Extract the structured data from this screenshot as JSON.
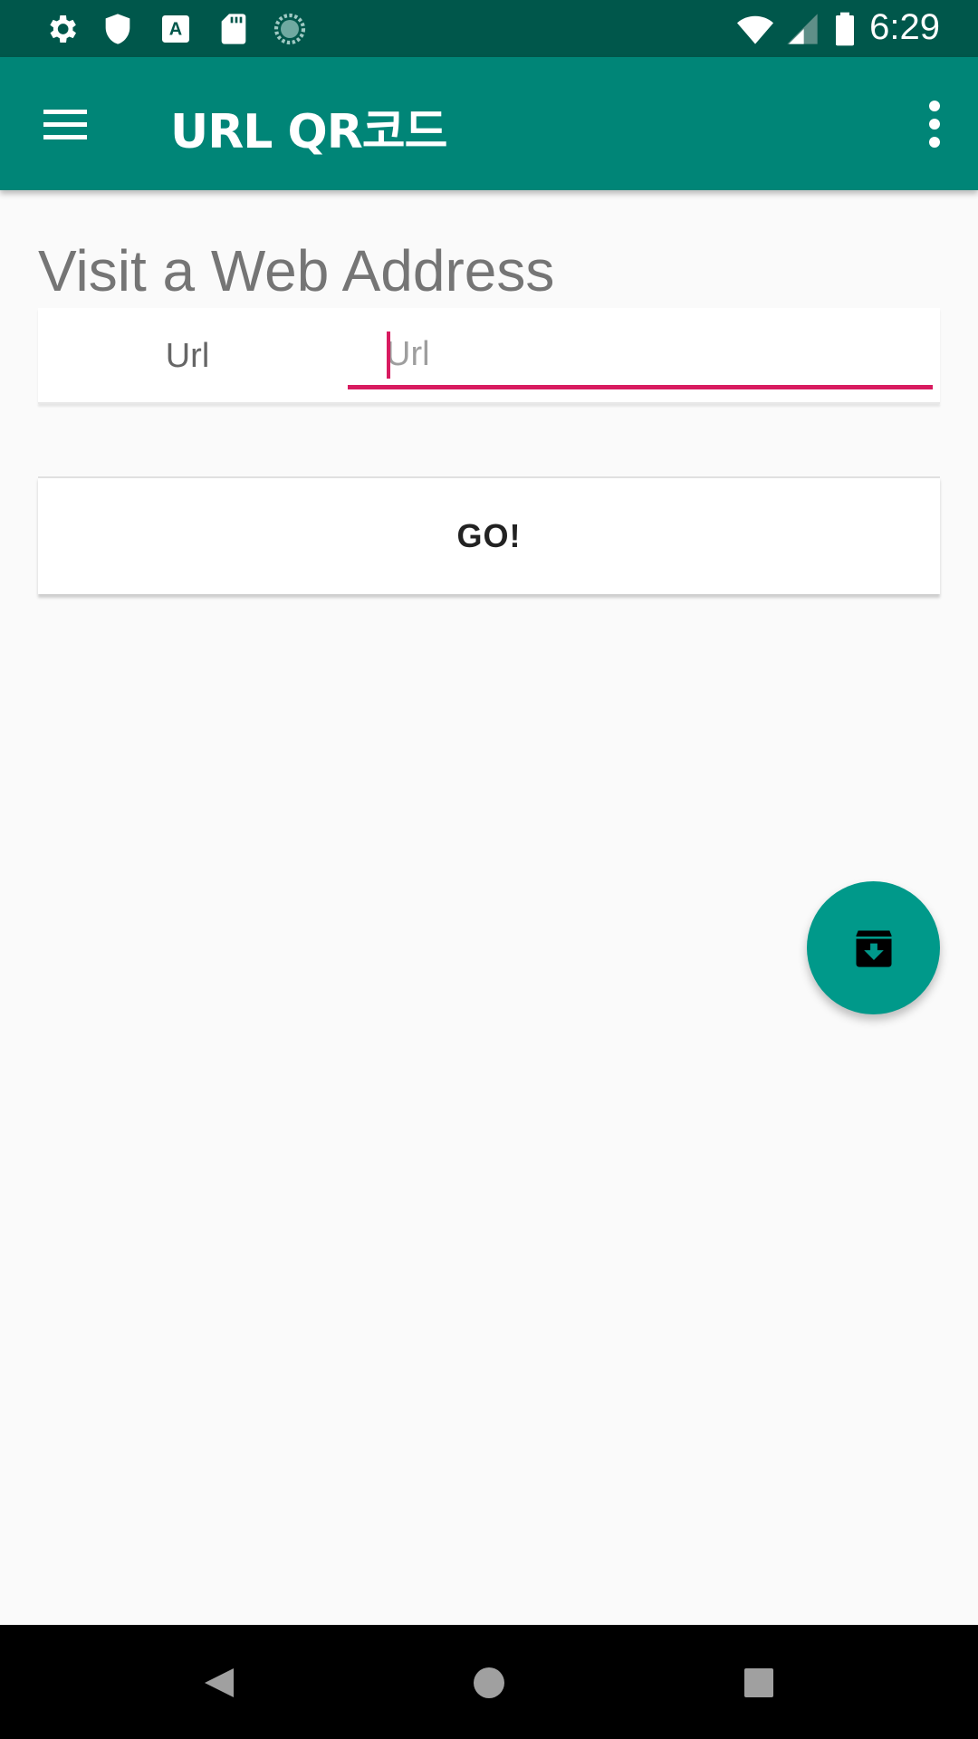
{
  "status_bar": {
    "time": "6:29",
    "left_icons": [
      "settings-icon",
      "shield-icon",
      "a-keyboard-icon",
      "sd-card-icon",
      "sync-icon"
    ],
    "right_icons": [
      "wifi-icon",
      "signal-icon",
      "battery-icon"
    ]
  },
  "app_bar": {
    "title": "URL QR코드",
    "menu_icon": "menu-icon",
    "overflow_icon": "more-vert-icon",
    "color": "#008577"
  },
  "main": {
    "heading": "Visit a Web Address",
    "url_label": "Url",
    "url_input": {
      "value": "",
      "placeholder": "Url"
    },
    "go_button_label": "GO!"
  },
  "fab": {
    "icon": "archive-download-icon",
    "color": "#00998a"
  },
  "nav_bar": {
    "buttons": [
      "back-icon",
      "home-icon",
      "recents-icon"
    ]
  },
  "colors": {
    "status_bar": "#00574b",
    "accent": "#d81b60"
  }
}
